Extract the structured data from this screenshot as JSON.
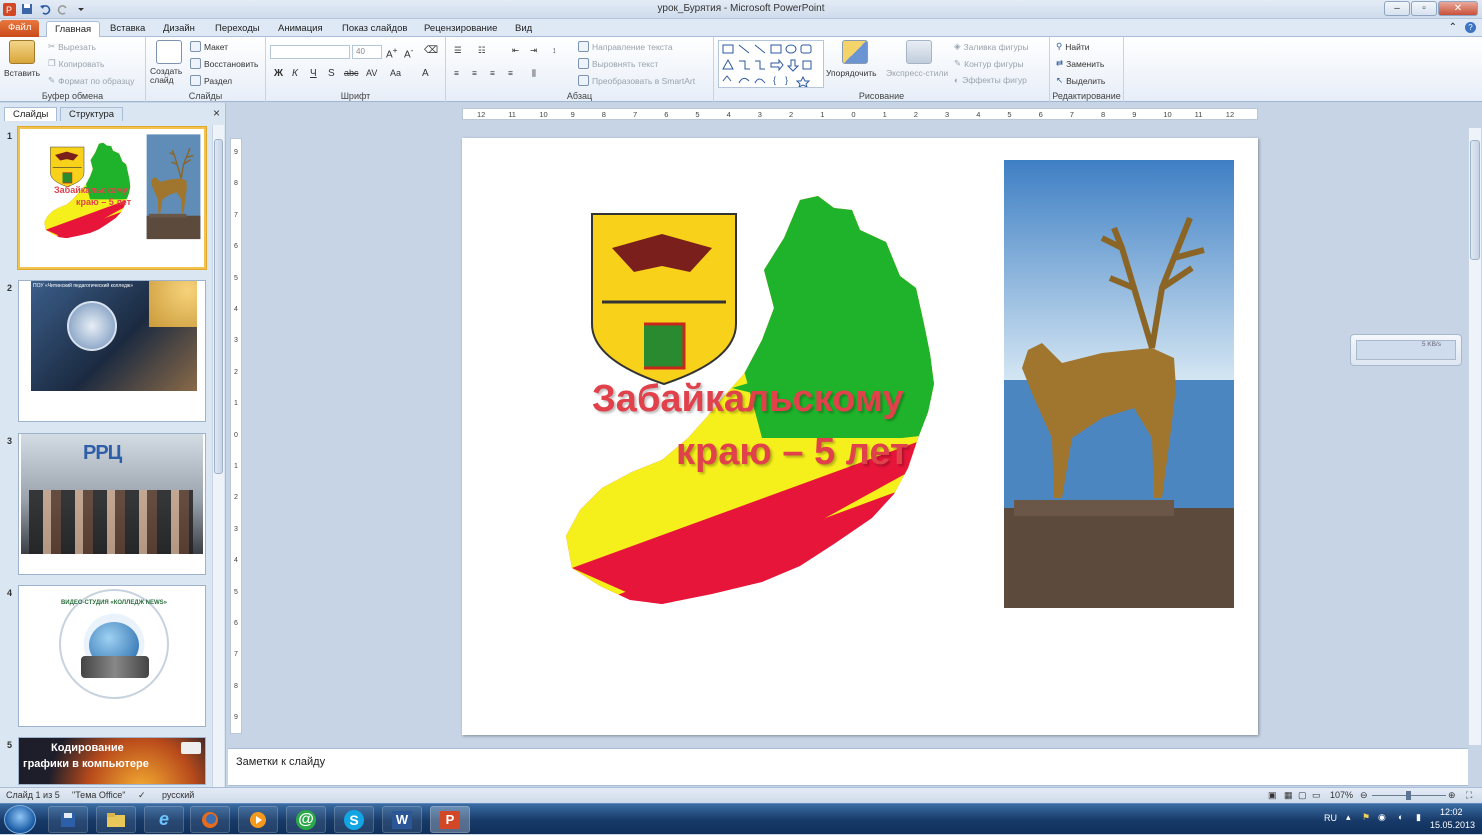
{
  "window": {
    "title": "урок_Бурятия - Microsoft PowerPoint"
  },
  "ribbon_tabs": [
    "Файл",
    "Главная",
    "Вставка",
    "Дизайн",
    "Переходы",
    "Анимация",
    "Показ слайдов",
    "Рецензирование",
    "Вид"
  ],
  "clipboard": {
    "paste": "Вставить",
    "cut": "Вырезать",
    "copy": "Копировать",
    "format_painter": "Формат по образцу",
    "label": "Буфер обмена"
  },
  "slides_group": {
    "new_slide": "Создать слайд",
    "layout": "Макет",
    "reset": "Восстановить",
    "section": "Раздел",
    "label": "Слайды"
  },
  "font_group": {
    "font_size": "40",
    "label": "Шрифт",
    "bold": "Ж",
    "italic": "К",
    "underline": "Ч",
    "strike": "abc",
    "shadow": "S"
  },
  "paragraph_group": {
    "text_direction": "Направление текста",
    "align_text": "Выровнять текст",
    "smartart": "Преобразовать в SmartArt",
    "label": "Абзац"
  },
  "drawing_group": {
    "arrange": "Упорядочить",
    "quick_styles": "Экспресс-стили",
    "fill": "Заливка фигуры",
    "outline": "Контур фигуры",
    "effects": "Эффекты фигур",
    "label": "Рисование"
  },
  "editing_group": {
    "find": "Найти",
    "replace": "Заменить",
    "select": "Выделить",
    "label": "Редактирование"
  },
  "side_pane": {
    "tab_slides": "Слайды",
    "tab_outline": "Структура",
    "close": "×"
  },
  "thumbnails": [
    {
      "num": "1",
      "title_line1": "Забайкальскому",
      "title_line2": "краю – 5 лет"
    },
    {
      "num": "2",
      "caption": "ПОУ «Читинский педагогический колледж»"
    },
    {
      "num": "3",
      "logo": "РРЦ"
    },
    {
      "num": "4",
      "ring_text": "ВИДЕО-СТУДИЯ «КОЛЛЕДЖ NEWS»"
    },
    {
      "num": "5",
      "line1": "Кодирование",
      "line2": "графики в компьютере"
    }
  ],
  "slide": {
    "title_line1": "Забайкальскому",
    "title_line2": "краю – 5 лет"
  },
  "ruler": {
    "h_ticks": [
      "12",
      "11",
      "10",
      "9",
      "8",
      "7",
      "6",
      "5",
      "4",
      "3",
      "2",
      "1",
      "0",
      "1",
      "2",
      "3",
      "4",
      "5",
      "6",
      "7",
      "8",
      "9",
      "10",
      "11",
      "12"
    ],
    "v_ticks": [
      "9",
      "8",
      "7",
      "6",
      "5",
      "4",
      "3",
      "2",
      "1",
      "0",
      "1",
      "2",
      "3",
      "4",
      "5",
      "6",
      "7",
      "8",
      "9"
    ]
  },
  "net_widget": {
    "speed": "5 KB/s"
  },
  "notes": {
    "placeholder": "Заметки к слайду"
  },
  "status": {
    "slide_count": "Слайд 1 из 5",
    "theme": "\"Тема Office\"",
    "language": "русский",
    "zoom": "107%"
  },
  "tray": {
    "lang": "RU",
    "time": "12:02",
    "date": "15.05.2013"
  },
  "colors": {
    "map_green": "#1fb32b",
    "map_yellow": "#f5ef1c",
    "map_red": "#e8153a",
    "title_red": "#e0414b",
    "accent_file": "#d65f2b"
  }
}
